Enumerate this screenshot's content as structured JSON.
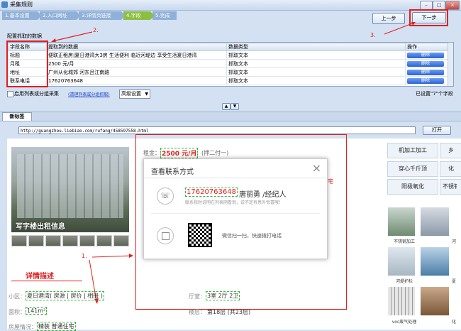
{
  "window": {
    "title": "采集规则",
    "min": "–",
    "max": "□",
    "close": "×"
  },
  "steps": [
    {
      "label": "1.基本设置",
      "active": false
    },
    {
      "label": "2.入口网址",
      "active": false
    },
    {
      "label": "3.详情页链接",
      "active": false
    },
    {
      "label": "4.字段",
      "active": true
    },
    {
      "label": "5.完成",
      "active": false
    }
  ],
  "nav": {
    "prev": "上一步",
    "next": "下一步"
  },
  "annotations": {
    "n1": "1.",
    "n2": "2.",
    "n3": "3."
  },
  "fields": {
    "section_title": "配置抓取的数据",
    "columns": [
      "字段名称",
      "提取到的数据",
      "数据类型",
      "操作"
    ],
    "rows": [
      {
        "name": "标题",
        "data": "便联正租房|夏日港湾大3房 生活便利 临近河堤边 享受生活夏日港湾",
        "type": "抓取文本",
        "op": "删除"
      },
      {
        "name": "月租",
        "data": "2500 元/月",
        "type": "抓取文本",
        "op": "删除"
      },
      {
        "name": "地址",
        "data": "广州从化城郊          河东吕江南路",
        "type": "抓取文本",
        "op": "删除"
      },
      {
        "name": "联系电话",
        "data": "17620763648",
        "type": "抓取文本",
        "op": "删除"
      }
    ],
    "split_label": "启用列表或分组采集",
    "clear_link": "(清理列表或分组抓取)",
    "advanced": "高级设置",
    "status": "已设置\"7\"个字段"
  },
  "browser": {
    "tab": "新标签",
    "url": "http://guangzhou.liebiao.com/rufang/458597558.html",
    "open": "打开"
  },
  "listing": {
    "photo_caption": "写字楼出租信息",
    "rent_label": "租金：",
    "rent_value": "2500 元/月",
    "rent_note": "(押二付一)",
    "behind_text": "宅",
    "detail_heading": "详情描述",
    "community_label": "小区：",
    "community_value": "夏日港湾( 房源 | 房价 | 相册 )",
    "area_label": "面积：",
    "area_value": "141m²",
    "decor_label": "房屋情况：",
    "decor_value": "精装 普通住宅",
    "layout_label": "厅室：",
    "layout_value": "3室 2厅 2卫",
    "floor_label": "楼层：",
    "floor_value": "第18层 (共23层)"
  },
  "popup": {
    "title": "查看联系方式",
    "phone": "17620763648",
    "agent": "唐丽勇 /经纪人",
    "hint": "联系我时说明在列表网看到，说不定有意外惊喜哦！",
    "wechat": "微信扫一扫，快速拨打电话"
  },
  "sidebar": {
    "tags": [
      "机加工加工",
      "穿心千斤顶",
      "阳极氧化"
    ],
    "tags_partial": [
      "乡",
      "化",
      "不锈钅"
    ],
    "captions": [
      "不锈钢加工",
      "河堤护栏",
      "voc废气处理"
    ],
    "captions_partial": [
      "河",
      "夏",
      "化"
    ]
  },
  "colors": {
    "accent_red": "#e02020",
    "step_active": "#8cbf3f",
    "step_inactive": "#8fb0d8",
    "price_red": "#e02020",
    "heading_red": "#e02020"
  }
}
